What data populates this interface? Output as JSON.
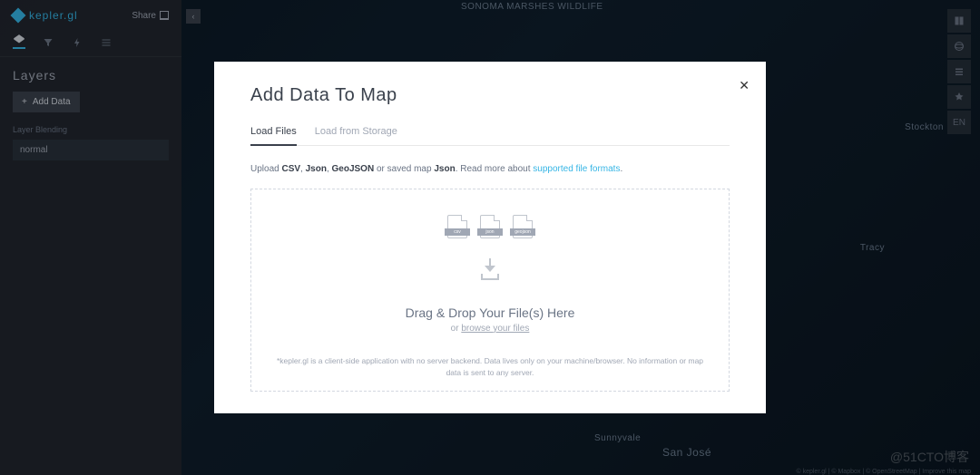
{
  "app": {
    "name": "kepler.gl",
    "share_label": "Share"
  },
  "map_labels": {
    "sonoma": "SONOMA MARSHES WILDLIFE",
    "stockton": "Stockton",
    "tracy": "Tracy",
    "sunnyvale": "Sunnyvale",
    "san_jose": "San José"
  },
  "sidebar": {
    "section_title": "Layers",
    "add_data_label": "Add Data",
    "blending_label": "Layer Blending",
    "blending_value": "normal"
  },
  "right_toolbar": {
    "locale": "EN"
  },
  "modal": {
    "title": "Add Data To Map",
    "tabs": {
      "load_files": "Load Files",
      "load_storage": "Load from Storage"
    },
    "upload_prefix": "Upload ",
    "formats": {
      "csv": "CSV",
      "json": "Json",
      "geojson": "GeoJSON"
    },
    "upload_mid": " or saved map ",
    "upload_json": "Json",
    "upload_suffix": ". Read more about ",
    "supported_link": "supported file formats",
    "file_icon_labels": {
      "csv": "csv",
      "json": "json",
      "geojson": "geojson"
    },
    "drop_text": "Drag & Drop Your File(s) Here",
    "browse_prefix": "or ",
    "browse_link": "browse your files",
    "disclaimer": "*kepler.gl is a client-side application with no server backend. Data lives only on your machine/browser. No information or map data is sent to any server."
  },
  "watermark": "@51CTO博客",
  "attribution": "© kepler.gl | © Mapbox | © OpenStreetMap | Improve this map"
}
